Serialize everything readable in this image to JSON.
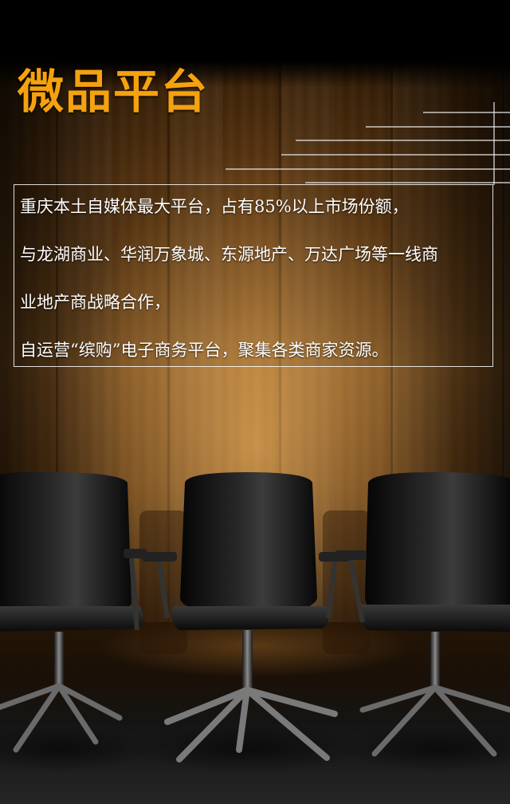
{
  "page": {
    "title": "微品平台",
    "description_lines": [
      "重庆本土自媒体最大平台，占有85%以上市场份额，",
      "与龙湖商业、华润万象城、东源地产、万达广场等一线商",
      "业地产商战略合作，",
      "自运营“缤购”电子商务平台，聚集各类商家资源。"
    ]
  },
  "colors": {
    "title": "#f5a20f",
    "text": "#ffffff",
    "wood": "#9a6428"
  }
}
